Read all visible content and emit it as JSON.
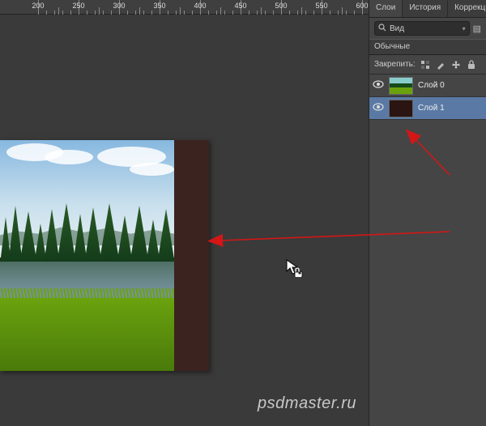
{
  "ruler": {
    "marks": [
      200,
      250,
      300,
      350,
      400,
      450,
      500,
      550,
      600
    ],
    "offset": -153
  },
  "panels": {
    "tabs": [
      "Слои",
      "История",
      "Коррекция"
    ],
    "active_tab": 0,
    "search": {
      "icon": "search-icon",
      "label": "Вид"
    },
    "blend_header": "Обычные",
    "lock": {
      "label": "Закрепить:",
      "icons": [
        "pixels-icon",
        "brush-icon",
        "move-icon",
        "lock-icon"
      ]
    },
    "layers": [
      {
        "name": "Слой 0",
        "thumb": "landscape",
        "visible": true,
        "selected": false
      },
      {
        "name": "Слой 1",
        "thumb": "brown",
        "visible": true,
        "selected": true
      }
    ]
  },
  "watermark": "psdmaster.ru"
}
